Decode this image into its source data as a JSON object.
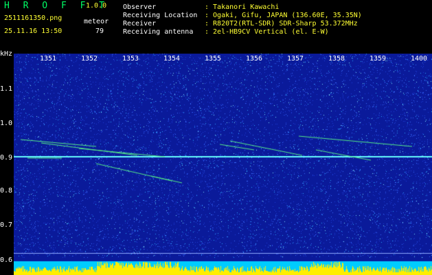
{
  "app": {
    "title": "H R O F F T",
    "version": "1.0.0"
  },
  "file": {
    "name": "2511161350.png",
    "datetime": "25.11.16 13:50"
  },
  "meteor": {
    "label": "meteor",
    "count": "79"
  },
  "info": [
    {
      "label": "Observer",
      "value": ": Takanori Kawachi"
    },
    {
      "label": "Receiving Location",
      "value": ": Ogaki, Gifu, JAPAN (136.60E, 35.35N)"
    },
    {
      "label": "Receiver",
      "value": ": R820T2(RTL-SDR) SDR-Sharp 53.372MHz"
    },
    {
      "label": "Receiving antenna",
      "value": ": 2el-HB9CV Vertical (el. E-W)"
    }
  ],
  "axis": {
    "unit": "kHz",
    "x_ticks": [
      "1351",
      "1352",
      "1353",
      "1354",
      "1355",
      "1356",
      "1357",
      "1358",
      "1359",
      "1400"
    ],
    "y_ticks": [
      "1.1",
      "1.0",
      "0.9",
      "0.8",
      "0.7",
      "0.6"
    ]
  },
  "colors": {
    "background": "#0a1a9a",
    "carrier": "#66ffff",
    "meteor_trail": "#55ee88",
    "level_bar": "#ffee00",
    "base_band": "#00ccff"
  },
  "chart_data": {
    "type": "heatmap",
    "xlabel": "",
    "ylabel": "kHz",
    "x_categories": [
      "1351",
      "1352",
      "1353",
      "1354",
      "1355",
      "1356",
      "1357",
      "1358",
      "1359",
      "1400"
    ],
    "ylim": [
      0.58,
      1.18
    ],
    "carrier_khz": 0.905
  }
}
